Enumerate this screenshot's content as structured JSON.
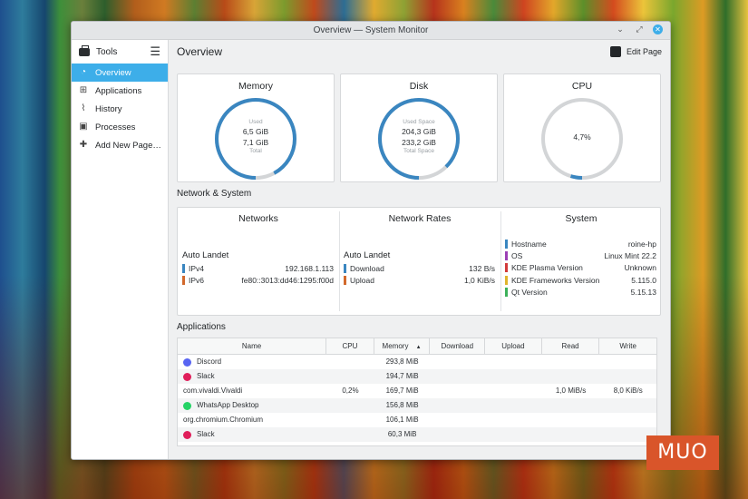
{
  "window": {
    "title": "Overview — System Monitor"
  },
  "sidebar": {
    "header": "Tools",
    "items": [
      {
        "label": "Overview",
        "icon": "overview-icon",
        "active": true
      },
      {
        "label": "Applications",
        "icon": "grid-icon",
        "active": false
      },
      {
        "label": "History",
        "icon": "chart-icon",
        "active": false
      },
      {
        "label": "Processes",
        "icon": "terminal-icon",
        "active": false
      },
      {
        "label": "Add New Page…",
        "icon": "plus-icon",
        "active": false
      }
    ]
  },
  "header": {
    "title": "Overview",
    "edit_label": "Edit Page"
  },
  "gauges": {
    "memory": {
      "title": "Memory",
      "top_label": "Used",
      "used": "6,5 GiB",
      "total": "7,1 GiB",
      "bottom_label": "Total",
      "fraction": 0.92,
      "color": "#3a86c0"
    },
    "disk": {
      "title": "Disk",
      "top_label": "Used Space",
      "used": "204,3 GiB",
      "total": "233,2 GiB",
      "bottom_label": "Total Space",
      "fraction": 0.876,
      "color": "#3a86c0"
    },
    "cpu": {
      "title": "CPU",
      "value": "4,7%",
      "fraction": 0.047,
      "color": "#3a86c0"
    }
  },
  "network_section": {
    "label": "Network & System"
  },
  "networks": {
    "title": "Networks",
    "connection": "Auto Landet",
    "rows": [
      {
        "key": "IPv4",
        "value": "192.168.1.113",
        "color": "#3a86c0"
      },
      {
        "key": "IPv6",
        "value": "fe80::3013:dd46:1295:f00d",
        "color": "#d2692c"
      }
    ]
  },
  "network_rates": {
    "title": "Network Rates",
    "connection": "Auto Landet",
    "rows": [
      {
        "key": "Download",
        "value": "132 B/s",
        "color": "#3a86c0"
      },
      {
        "key": "Upload",
        "value": "1,0 KiB/s",
        "color": "#d2692c"
      }
    ]
  },
  "system": {
    "title": "System",
    "rows": [
      {
        "key": "Hostname",
        "value": "roine-hp",
        "color": "#3a86c0"
      },
      {
        "key": "OS",
        "value": "Linux Mint 22.2",
        "color": "#9b3fb5"
      },
      {
        "key": "KDE Plasma Version",
        "value": "Unknown",
        "color": "#d23a3a"
      },
      {
        "key": "KDE Frameworks Version",
        "value": "5.115.0",
        "color": "#e0b42c"
      },
      {
        "key": "Qt Version",
        "value": "5.15.13",
        "color": "#3cb15a"
      }
    ]
  },
  "applications": {
    "label": "Applications",
    "columns": [
      "Name",
      "CPU",
      "Memory",
      "Download",
      "Upload",
      "Read",
      "Write"
    ],
    "sort_indicator": "▲",
    "rows": [
      {
        "name": "Discord",
        "icon_color": "#5865f2",
        "cpu": "",
        "memory": "293,8 MiB",
        "download": "",
        "upload": "",
        "read": "",
        "write": ""
      },
      {
        "name": "Slack",
        "icon_color": "#e01e5a",
        "cpu": "",
        "memory": "194,7 MiB",
        "download": "",
        "upload": "",
        "read": "",
        "write": ""
      },
      {
        "name": "com.vivaldi.Vivaldi",
        "icon_color": "",
        "cpu": "0,2%",
        "memory": "169,7 MiB",
        "download": "",
        "upload": "",
        "read": "1,0 MiB/s",
        "write": "8,0 KiB/s"
      },
      {
        "name": "WhatsApp Desktop",
        "icon_color": "#25d366",
        "cpu": "",
        "memory": "156,8 MiB",
        "download": "",
        "upload": "",
        "read": "",
        "write": ""
      },
      {
        "name": "org.chromium.Chromium",
        "icon_color": "",
        "cpu": "",
        "memory": "106,1 MiB",
        "download": "",
        "upload": "",
        "read": "",
        "write": ""
      },
      {
        "name": "Slack",
        "icon_color": "#e01e5a",
        "cpu": "",
        "memory": "60,3 MiB",
        "download": "",
        "upload": "",
        "read": "",
        "write": ""
      }
    ]
  },
  "watermark": "MUO"
}
